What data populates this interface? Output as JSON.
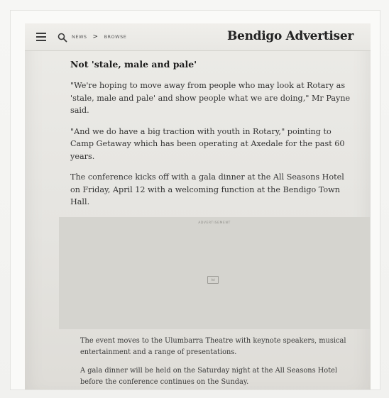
{
  "header": {
    "menu_icon": "hamburger-menu-icon",
    "search_icon": "search-icon",
    "breadcrumb": [
      "NEWS",
      "BROWSE"
    ],
    "breadcrumb_separator": ">",
    "brand": "Bendigo Advertiser"
  },
  "article": {
    "heading": "Not 'stale, male and pale'",
    "paragraphs": [
      "\"We're hoping to move away from people who may look at Rotary as 'stale, male and pale' and show people what we are doing,\" Mr Payne said.",
      "\"And we do have a big traction with youth in Rotary,\" pointing to Camp Getaway which has been operating at Axedale for the past 60 years.",
      "The conference kicks off with a gala dinner at the All Seasons Hotel on Friday, April 12 with a welcoming function at the Bendigo Town Hall."
    ],
    "paragraphs_after_ad": [
      "The event moves to the Ulumbarra Theatre with keynote speakers, musical entertainment and a range of presentations.",
      "A gala dinner will be held on the Saturday night at the All Seasons Hotel before the conference continues on the Sunday."
    ]
  },
  "advertisement": {
    "label": "ADVERTISEMENT",
    "badge": "Ad"
  }
}
